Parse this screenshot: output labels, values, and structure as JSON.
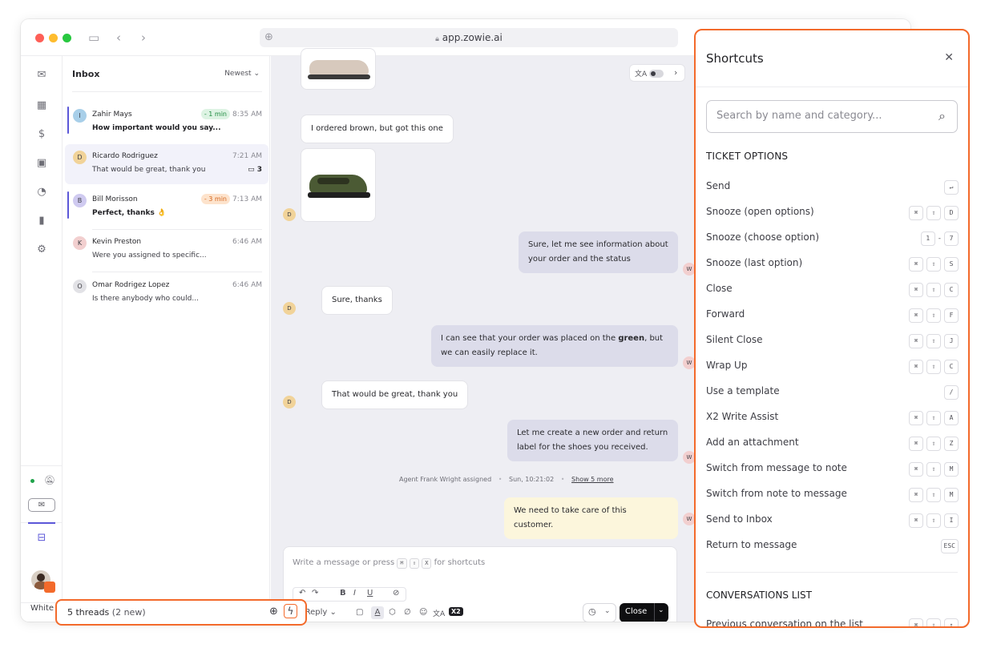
{
  "browser": {
    "url": "app.zowie.ai"
  },
  "inbox": {
    "title": "Inbox",
    "sort": "Newest",
    "threads": [
      {
        "initial": "I",
        "name": "Zahir Mays",
        "badge": "- 1 min",
        "time": "8:35 AM",
        "message": "How important would you say..."
      },
      {
        "initial": "D",
        "name": "Ricardo Rodriguez",
        "time": "7:21 AM",
        "message": "That would be great, thank you",
        "count": "3"
      },
      {
        "initial": "B",
        "name": "Bill Morisson",
        "badge": "- 3 min",
        "time": "7:13 AM",
        "message": "Perfect, thanks 👌"
      },
      {
        "initial": "K",
        "name": "Kevin Preston",
        "time": "6:46 AM",
        "message": "Were you assigned to specific..."
      },
      {
        "initial": "O",
        "name": "Omar Rodrigez Lopez",
        "time": "6:46 AM",
        "message": "Is there anybody who could..."
      }
    ]
  },
  "conversation": {
    "msg_ordered": "I ordered brown, but got this one",
    "msg_agent1": "Sure, let me see information about your order and the status",
    "msg_cust2": "Sure, thanks",
    "msg_agent2_a": "I can see that your order was placed on the ",
    "msg_agent2_b": "green",
    "msg_agent2_c": ", but we can easily replace it.",
    "msg_cust3": "That would be great, thank you",
    "msg_agent3": "Let me create a new order and return label for the shoes you received.",
    "system": "Agent Frank Wright assigned",
    "system_time": "Sun, 10:21:02",
    "system_link": "Show 5 more",
    "note": "We need to take care of this customer.",
    "avatar_cust": "D",
    "avatar_agent": "W"
  },
  "composer": {
    "placeholder_a": "Write a message or press",
    "placeholder_b": "for shortcuts",
    "keys": [
      "⌘",
      "⇧",
      "X"
    ],
    "reply_label": "Reply",
    "close_label": "Close",
    "x2_label": "X2"
  },
  "footer": {
    "threads_label": "5 threads",
    "threads_new": "(2 new)",
    "white_label": "White"
  },
  "shortcuts": {
    "title": "Shortcuts",
    "search_placeholder": "Search by name and category...",
    "section1": "TICKET OPTIONS",
    "section2": "CONVERSATIONS LIST",
    "items": [
      {
        "label": "Send",
        "keys": [
          "↵"
        ]
      },
      {
        "label": "Snooze (open options)",
        "keys": [
          "⌘",
          "⇧",
          "D"
        ]
      },
      {
        "label": "Snooze (choose option)",
        "keys": [
          "1",
          "-",
          "7"
        ]
      },
      {
        "label": "Snooze (last option)",
        "keys": [
          "⌘",
          "⇧",
          "S"
        ]
      },
      {
        "label": "Close",
        "keys": [
          "⌘",
          "⇧",
          "C"
        ]
      },
      {
        "label": "Forward",
        "keys": [
          "⌘",
          "⇧",
          "F"
        ]
      },
      {
        "label": "Silent Close",
        "keys": [
          "⌘",
          "⇧",
          "J"
        ]
      },
      {
        "label": "Wrap Up",
        "keys": [
          "⌘",
          "⇧",
          "C"
        ]
      },
      {
        "label": "Use a template",
        "keys": [
          "/"
        ]
      },
      {
        "label": "X2 Write Assist",
        "keys": [
          "⌘",
          "⇧",
          "A"
        ]
      },
      {
        "label": "Add an attachment",
        "keys": [
          "⌘",
          "⇧",
          "Z"
        ]
      },
      {
        "label": "Switch from message to note",
        "keys": [
          "⌘",
          "⇧",
          "M"
        ]
      },
      {
        "label": "Switch from note to message",
        "keys": [
          "⌘",
          "⇧",
          "M"
        ]
      },
      {
        "label": "Send to Inbox",
        "keys": [
          "⌘",
          "⇧",
          "I"
        ]
      },
      {
        "label": "Return to message",
        "keys": [
          "ESC"
        ]
      }
    ],
    "last_item": {
      "label": "Previous conversation on the list",
      "keys": [
        "⌘",
        "⇧",
        "↑"
      ]
    }
  },
  "colors": {
    "accent": "#f36a2b",
    "brand_purple": "#5b57d8",
    "agent_bubble": "#dcdcea",
    "note_bubble": "#fcf6dc"
  }
}
